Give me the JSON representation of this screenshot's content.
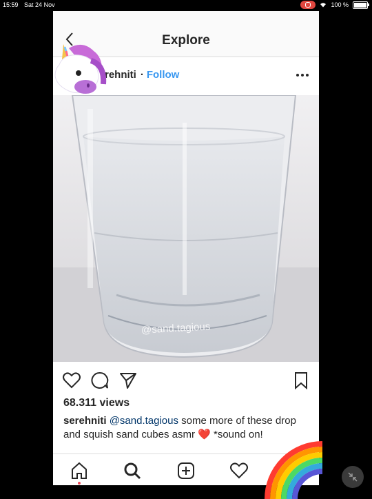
{
  "status_bar": {
    "time": "15:59",
    "date": "Sat 24 Nov",
    "battery": "100 %"
  },
  "nav": {
    "title": "Explore",
    "back_icon": "chevron-left-icon"
  },
  "post": {
    "username_partial": "rehniti",
    "dot": "·",
    "follow_label": "Follow",
    "more_icon": "more-horizontal-icon",
    "media_watermark": "@sand.tagious",
    "views": "68.311 views",
    "caption": {
      "username": "serehniti",
      "mention": "@sand.tagious",
      "text": " some more of these drop and squish sand cubes asmr ",
      "emoji": "❤️",
      "text_end": " *sound on!"
    }
  },
  "actions": [
    "heart-icon",
    "comment-icon",
    "share-icon",
    "bookmark-icon"
  ],
  "tabbar": [
    "home-icon",
    "search-icon",
    "new-post-icon",
    "activity-icon"
  ],
  "colors": {
    "follow": "#3897f0",
    "mention": "#003569",
    "background": "#000000",
    "notification_dot": "#ed4956"
  }
}
